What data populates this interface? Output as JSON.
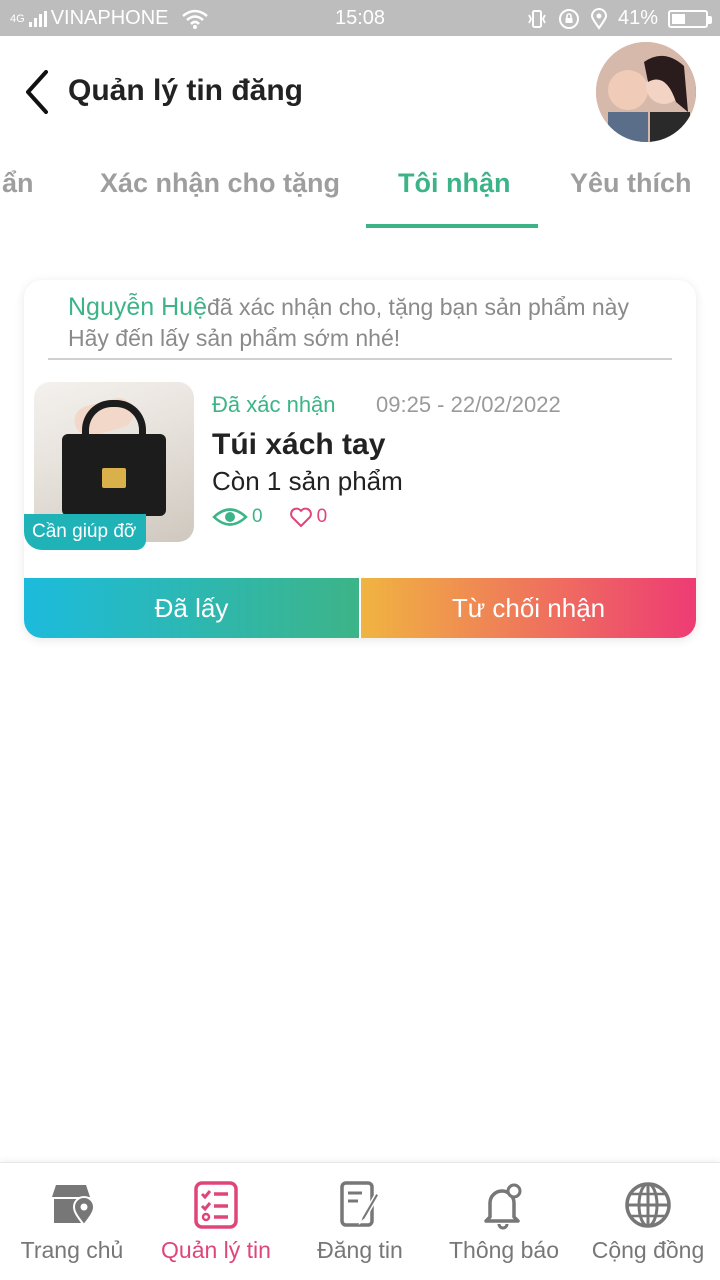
{
  "status_bar": {
    "network": "4G",
    "carrier": "VINAPHONE",
    "time": "15:08",
    "battery": "41%",
    "battery_level": 0.41
  },
  "header": {
    "title": "Quản lý tin đăng"
  },
  "tabs": {
    "items": [
      {
        "label": "ẩn",
        "active": false
      },
      {
        "label": "Xác nhận cho tặng",
        "active": false
      },
      {
        "label": "Tôi nhận",
        "active": true
      },
      {
        "label": "Yêu thích",
        "active": false
      }
    ]
  },
  "card": {
    "giver_name": "Nguyễn Huệ",
    "notice_text": "đã xác nhận cho, tặng bạn sản phẩm này",
    "notice_line2": "Hãy đến lấy sản phẩm sớm nhé!",
    "badge": "Cần giúp đỡ",
    "status": "Đã xác nhận",
    "datetime": "09:25 - 22/02/2022",
    "product_name": "Túi xách tay",
    "remaining": "Còn 1 sản phẩm",
    "views": "0",
    "likes": "0",
    "btn_taken": "Đã lấy",
    "btn_refuse": "Từ chối nhận"
  },
  "bottom_nav": {
    "items": [
      {
        "label": "Trang chủ",
        "icon": "store-location-icon",
        "active": false
      },
      {
        "label": "Quản lý tin",
        "icon": "checklist-icon",
        "active": true
      },
      {
        "label": "Đăng tin",
        "icon": "document-edit-icon",
        "active": false
      },
      {
        "label": "Thông báo",
        "icon": "bell-icon",
        "active": false
      },
      {
        "label": "Cộng đồng",
        "icon": "globe-icon",
        "active": false
      }
    ]
  },
  "colors": {
    "accent_green": "#3db488",
    "accent_pink": "#e0457a",
    "badge_teal": "#1fb3b8"
  }
}
